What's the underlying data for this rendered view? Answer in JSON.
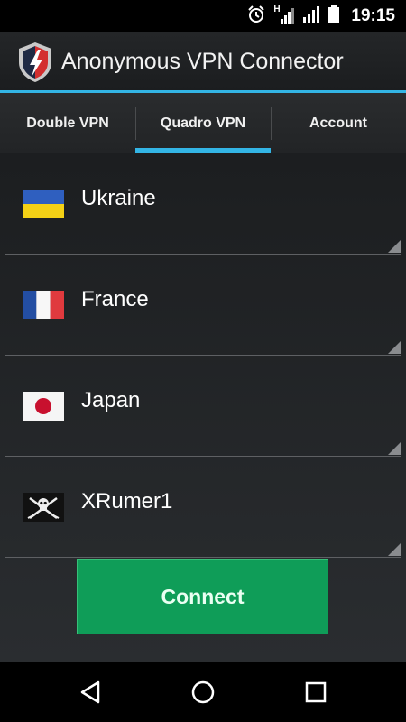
{
  "status": {
    "time": "19:15",
    "signal_badge": "H"
  },
  "app": {
    "title": "Anonymous VPN Connector"
  },
  "tabs": [
    {
      "label": "Double VPN",
      "active": false
    },
    {
      "label": "Quadro VPN",
      "active": true
    },
    {
      "label": "Account",
      "active": false
    }
  ],
  "servers": [
    {
      "name": "Ukraine",
      "flag": "ukraine-flag"
    },
    {
      "name": "France",
      "flag": "france-flag"
    },
    {
      "name": "Japan",
      "flag": "japan-flag"
    },
    {
      "name": "XRumer1",
      "flag": "jolly-roger-flag"
    }
  ],
  "connect": {
    "label": "Connect"
  },
  "colors": {
    "accent": "#33b5e5",
    "connect": "#0f9d58",
    "background": "#1c1e20"
  }
}
